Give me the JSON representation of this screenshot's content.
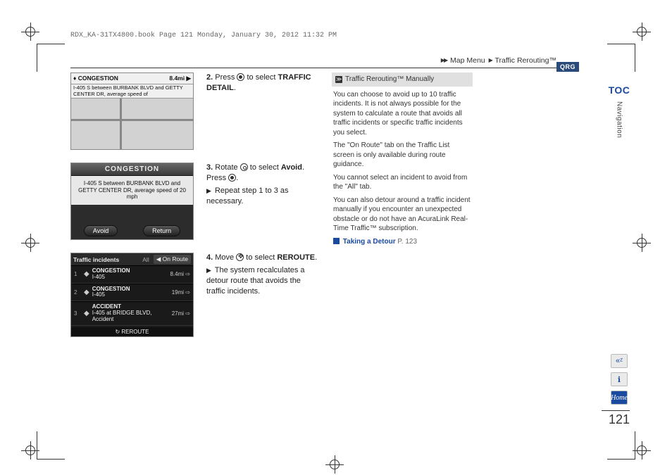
{
  "print_header": "RDX_KA-31TX4800.book  Page 121  Monday, January 30, 2012  11:32 PM",
  "breadcrumb": {
    "level1": "Map Menu",
    "level2": "Traffic Rerouting™"
  },
  "qrg_tab": "QRG",
  "rail": {
    "toc_label": "TOC",
    "section_label": "Navigation",
    "voice_icon": "voice-icon",
    "info_icon": "info-icon",
    "home_label": "Home"
  },
  "page_number": "121",
  "steps": {
    "s2": {
      "num": "2.",
      "pre": "Press ",
      "post": " to select ",
      "target": "TRAFFIC DETAIL",
      "tail": "."
    },
    "s3": {
      "num": "3.",
      "pre": "Rotate ",
      "mid": " to select ",
      "target": "Avoid",
      "post2": ". Press ",
      "tail": ".",
      "sub": "Repeat step 1 to 3 as necessary."
    },
    "s4": {
      "num": "4.",
      "pre": "Move ",
      "post": " to select ",
      "target": "REROUTE",
      "tail": ".",
      "sub": "The system recalculates a detour route that avoids the traffic incidents."
    }
  },
  "screens": {
    "shot1": {
      "banner_left": "♦ CONGESTION",
      "banner_right": "8.4mi ▶",
      "desc": "I-405 S between BURBANK BLVD and GETTY CENTER DR, average speed of"
    },
    "shot2": {
      "title": "CONGESTION",
      "body": "I-405 S between BURBANK BLVD and GETTY CENTER DR, average speed of 20 mph",
      "btn_left": "Avoid",
      "btn_right": "Return"
    },
    "shot3": {
      "title": "Traffic incidents",
      "tab_all": "All",
      "tab_onroute": "◀ On Route",
      "rows": [
        {
          "n": "1",
          "label": "CONGESTION",
          "road": "I-405",
          "dist": "8.4mi ⇨"
        },
        {
          "n": "2",
          "label": "CONGESTION",
          "road": "I-405",
          "dist": "19mi ⇨"
        },
        {
          "n": "3",
          "label": "ACCIDENT",
          "road": "I-405 at BRIDGE BLVD, Accident",
          "dist": "27mi ⇨"
        }
      ],
      "footer": "REROUTE"
    }
  },
  "sidebar": {
    "heading": "Traffic Rerouting™ Manually",
    "p1": "You can choose to avoid up to 10 traffic incidents. It is not always possible for the system to calculate a route that avoids all traffic incidents or specific traffic incidents you select.",
    "p2": "The \"On Route\" tab on the Traffic List screen is only available during route guidance.",
    "p3": "You cannot select an incident to avoid from the \"All\" tab.",
    "p4": "You can also detour around a traffic incident manually if you encounter an unexpected obstacle or do not have an AcuraLink Real-Time Traffic™ subscription.",
    "link_label": "Taking a Detour",
    "link_page": "P. 123"
  }
}
